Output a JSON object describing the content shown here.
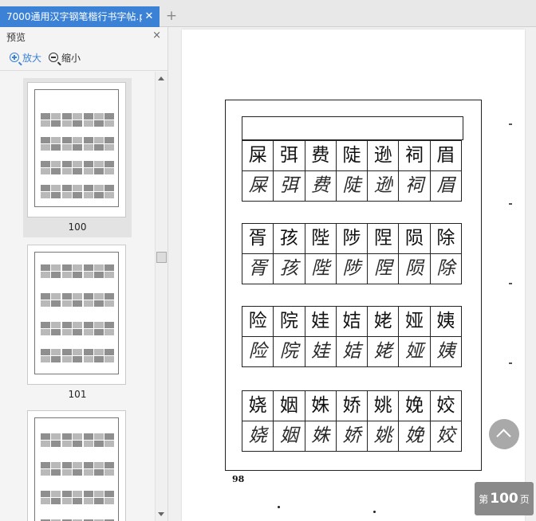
{
  "tab": {
    "title": "7000通用汉字钢笔楷行书字帖.p",
    "close_glyph": "✕",
    "new_tab_glyph": "+"
  },
  "sidebar": {
    "title": "预览",
    "close_glyph": "×",
    "zoom_in_label": "放大",
    "zoom_out_label": "缩小",
    "thumbnails": [
      {
        "label": "100",
        "selected": true
      },
      {
        "label": "101",
        "selected": false
      },
      {
        "label": "",
        "selected": false
      }
    ]
  },
  "page": {
    "number": "98",
    "groups": [
      {
        "model": [
          "屎",
          "弭",
          "费",
          "陡",
          "逊",
          "祠",
          "眉"
        ],
        "trace": [
          "屎",
          "弭",
          "费",
          "陡",
          "逊",
          "祠",
          "眉"
        ]
      },
      {
        "model": [
          "胥",
          "孩",
          "陛",
          "陟",
          "陧",
          "陨",
          "除"
        ],
        "trace": [
          "胥",
          "孩",
          "陛",
          "陟",
          "陧",
          "陨",
          "除"
        ]
      },
      {
        "model": [
          "险",
          "院",
          "娃",
          "姞",
          "姥",
          "娅",
          "姨"
        ],
        "trace": [
          "险",
          "院",
          "娃",
          "姞",
          "姥",
          "娅",
          "姨"
        ]
      },
      {
        "model": [
          "娆",
          "姻",
          "姝",
          "娇",
          "姚",
          "娩",
          "姣"
        ],
        "trace": [
          "娆",
          "姻",
          "姝",
          "娇",
          "姚",
          "娩",
          "姣"
        ]
      }
    ]
  },
  "page_indicator": {
    "prefix": "第",
    "value": "100",
    "suffix": "页"
  },
  "colors": {
    "accent": "#3b82d6",
    "badge": "#8a8a8a",
    "back_to_top": "#a9a9a9"
  },
  "icons": {
    "zoom_in": "zoom-in-icon",
    "zoom_out": "zoom-out-icon",
    "back_to_top": "chevron-up-icon"
  }
}
